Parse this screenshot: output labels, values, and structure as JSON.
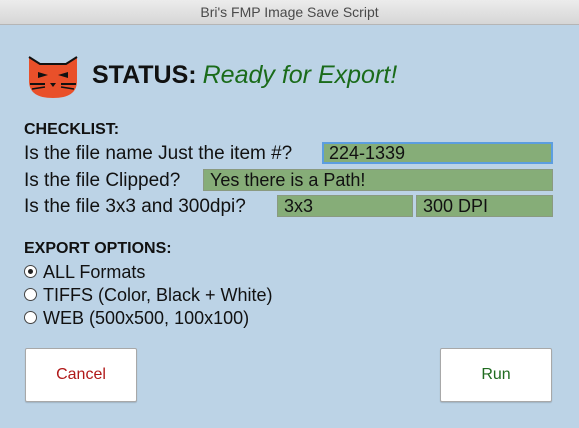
{
  "window": {
    "title": "Bri's FMP Image Save Script"
  },
  "status": {
    "label": "STATUS:",
    "value": "Ready for Export!"
  },
  "checklist": {
    "title": "CHECKLIST:",
    "items": [
      {
        "question": "Is the file name Just the item #?",
        "value": "224-1339"
      },
      {
        "question": "Is the file Clipped?",
        "value": "Yes there is a Path!"
      },
      {
        "question": "Is the file 3x3 and 300dpi?",
        "value_size": "3x3",
        "value_dpi": "300 DPI"
      }
    ]
  },
  "export_options": {
    "title": "EXPORT OPTIONS:",
    "options": [
      {
        "label": "ALL Formats",
        "selected": true
      },
      {
        "label": "TIFFS (Color, Black + White)",
        "selected": false
      },
      {
        "label": "WEB (500x500, 100x100)",
        "selected": false
      }
    ]
  },
  "buttons": {
    "cancel": "Cancel",
    "run": "Run"
  },
  "colors": {
    "background": "#bcd3e6",
    "field_fill": "#86ad78",
    "status_green": "#1a6b1a",
    "logo_orange": "#e9502a",
    "cancel_red": "#b01818",
    "run_green": "#1f6b1f"
  },
  "icons": {
    "logo": "cat-face-logo-icon"
  }
}
